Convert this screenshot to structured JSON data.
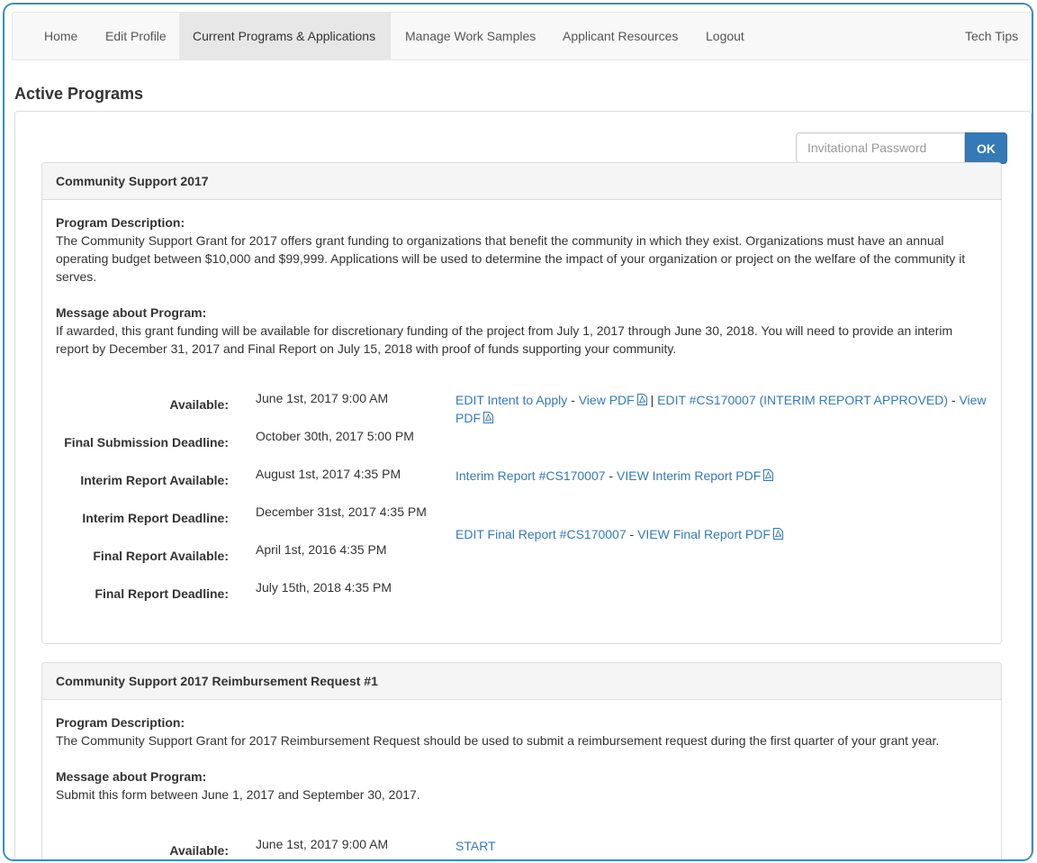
{
  "nav": {
    "items": [
      {
        "label": "Home"
      },
      {
        "label": "Edit Profile"
      },
      {
        "label": "Current Programs & Applications"
      },
      {
        "label": "Manage Work Samples"
      },
      {
        "label": "Applicant Resources"
      },
      {
        "label": "Logout"
      }
    ],
    "right": {
      "label": "Tech Tips"
    },
    "active_index": 2
  },
  "page_title": "Active Programs",
  "invite": {
    "placeholder": "Invitational Password",
    "ok_label": "OK"
  },
  "programs": [
    {
      "title": "Community Support 2017",
      "description_label": "Program Description:",
      "description": "The Community Support Grant for 2017 offers grant funding to organizations that benefit the community in which they exist. Organizations must have an annual operating budget between $10,000 and $99,999. Applications will be used to determine the impact of your organization or project on the welfare of the community it serves.",
      "message_label": "Message about Program:",
      "message": "If awarded, this grant funding will be available for discretionary funding of the project from July 1, 2017 through June 30, 2018. You will need to provide an interim report by December 31, 2017 and Final Report on July 15, 2018 with proof of funds supporting your community.",
      "rows": [
        {
          "label": "Available:",
          "date": "June 1st, 2017 9:00 AM"
        },
        {
          "label": "Final Submission Deadline:",
          "date": "October 30th, 2017 5:00 PM"
        },
        {
          "label": "Interim Report Available:",
          "date": "August 1st, 2017 4:35 PM"
        },
        {
          "label": "Interim Report Deadline:",
          "date": "December 31st, 2017 4:35 PM"
        },
        {
          "label": "Final Report Available:",
          "date": "April 1st, 2016 4:35 PM"
        },
        {
          "label": "Final Report Deadline:",
          "date": "July 15th, 2018 4:35 PM"
        }
      ],
      "links": {
        "edit_intent": "EDIT Intent to Apply",
        "view_pdf_1": "View PDF",
        "edit_interim": "EDIT #CS170007 (INTERIM REPORT APPROVED)",
        "view_pdf_2": "View PDF",
        "interim_report": "Interim Report #CS170007",
        "view_interim_pdf": "VIEW Interim Report PDF",
        "edit_final": "EDIT Final Report #CS170007",
        "view_final_pdf": "VIEW Final Report PDF",
        "sep_dash": " - ",
        "sep_pipe": " | "
      }
    },
    {
      "title": "Community Support 2017 Reimbursement Request #1",
      "description_label": "Program Description:",
      "description": "The Community Support Grant for 2017 Reimbursement Request should be used to submit a reimbursement request during the first quarter of your grant year.",
      "message_label": "Message about Program:",
      "message": "Submit this form between June 1, 2017 and September 30, 2017.",
      "rows": [
        {
          "label": "Available:",
          "date": "June 1st, 2017 9:00 AM"
        }
      ],
      "links": {
        "start": "START"
      }
    }
  ],
  "colors": {
    "link": "#337ab7",
    "button": "#337ab7",
    "frame": "#3a8ebc",
    "nav_bg": "#f8f8f8",
    "nav_active": "#e7e7e7"
  },
  "icons": [
    "pdf-file-icon"
  ]
}
